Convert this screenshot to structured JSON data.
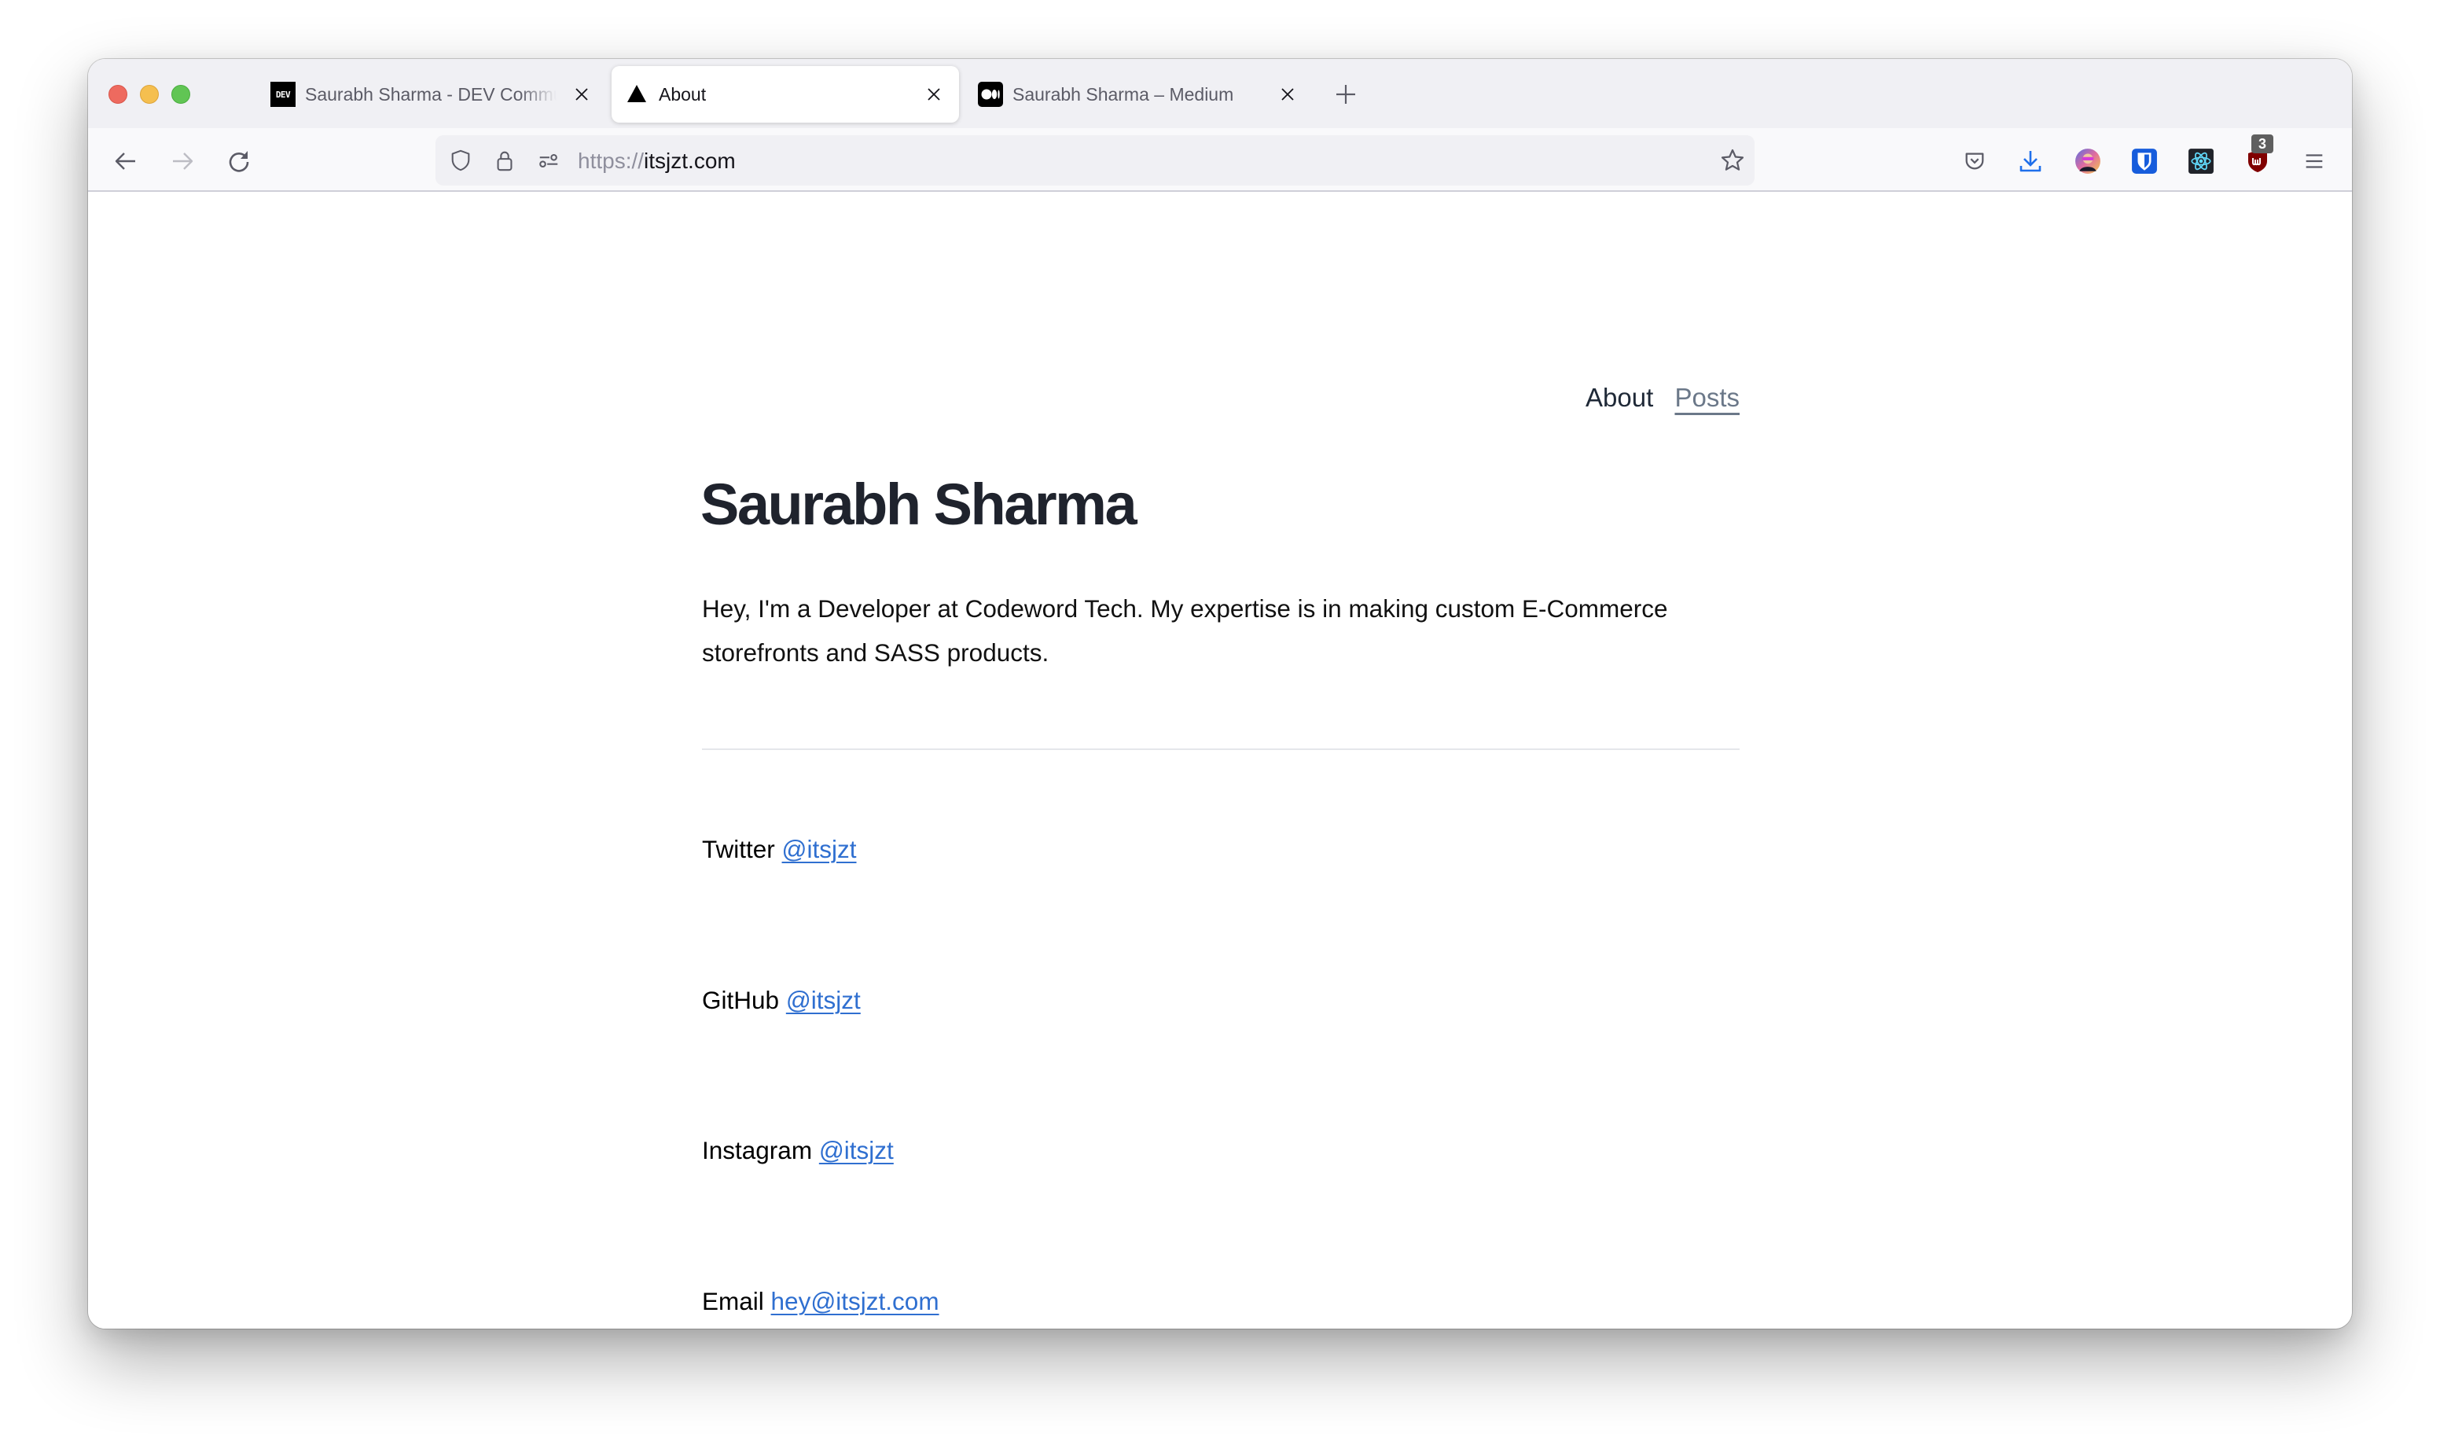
{
  "browser": {
    "tabs": [
      {
        "title": "Saurabh Sharma - DEV Community",
        "favicon": "dev-logo",
        "favicon_text": "DEV",
        "active": false
      },
      {
        "title": "About",
        "favicon": "triangle-logo",
        "active": true
      },
      {
        "title": "Saurabh Sharma – Medium",
        "favicon": "medium-logo",
        "active": false
      }
    ],
    "new_tab_icon": "plus-icon",
    "url": {
      "scheme": "https://",
      "host": "itsjzt.com"
    },
    "toolbar_icons": [
      "pocket-icon",
      "download-icon",
      "profile-avatar",
      "bitwarden-icon",
      "react-devtools-icon",
      "ublock-icon",
      "menu-icon"
    ],
    "ublock_badge": "3",
    "colors": {
      "download_blue": "#1f6feb",
      "bitwarden_blue": "#175ddc",
      "ublock_red": "#800000"
    }
  },
  "site": {
    "nav": {
      "about": "About",
      "posts": "Posts"
    },
    "title": "Saurabh Sharma",
    "intro": "Hey, I'm a Developer at Codeword Tech. My expertise is in making custom E-Commerce storefronts and SASS products.",
    "socials": [
      {
        "label": "Twitter",
        "link": "@itsjzt"
      },
      {
        "label": "GitHub",
        "link": "@itsjzt"
      },
      {
        "label": "Instagram",
        "link": "@itsjzt"
      },
      {
        "label": "Email",
        "link": "hey@itsjzt.com"
      }
    ],
    "colors": {
      "link": "#2f6fd0",
      "heading": "#1f232d",
      "muted_nav": "#6b7889"
    }
  }
}
